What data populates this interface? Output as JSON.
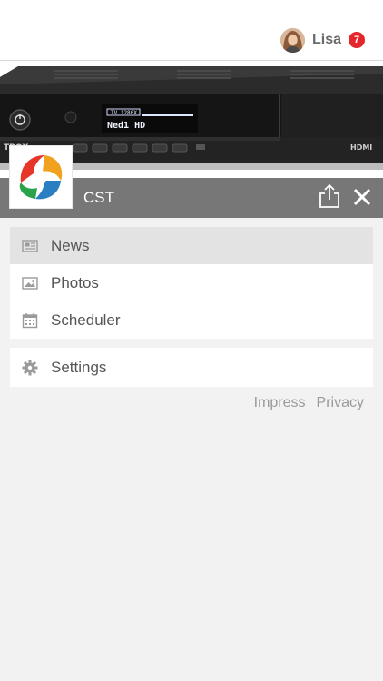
{
  "user": {
    "name": "Lisa",
    "notification_count": "7"
  },
  "header": {
    "title": "CST"
  },
  "hero": {
    "display_line1": "TV 1280X",
    "display_line2": "Ned1 HD",
    "brand_left": "TBOX",
    "brand_right": "HDMI"
  },
  "menu": {
    "items": [
      {
        "label": "News",
        "icon": "newspaper-icon",
        "active": true
      },
      {
        "label": "Photos",
        "icon": "image-icon",
        "active": false
      },
      {
        "label": "Scheduler",
        "icon": "calendar-icon",
        "active": false
      }
    ],
    "settings": {
      "label": "Settings",
      "icon": "gear-icon"
    }
  },
  "footer": {
    "impress": "Impress",
    "privacy": "Privacy"
  },
  "colors": {
    "badge": "#e3262b",
    "titlebar": "#777777",
    "active_item": "#e3e3e3"
  }
}
